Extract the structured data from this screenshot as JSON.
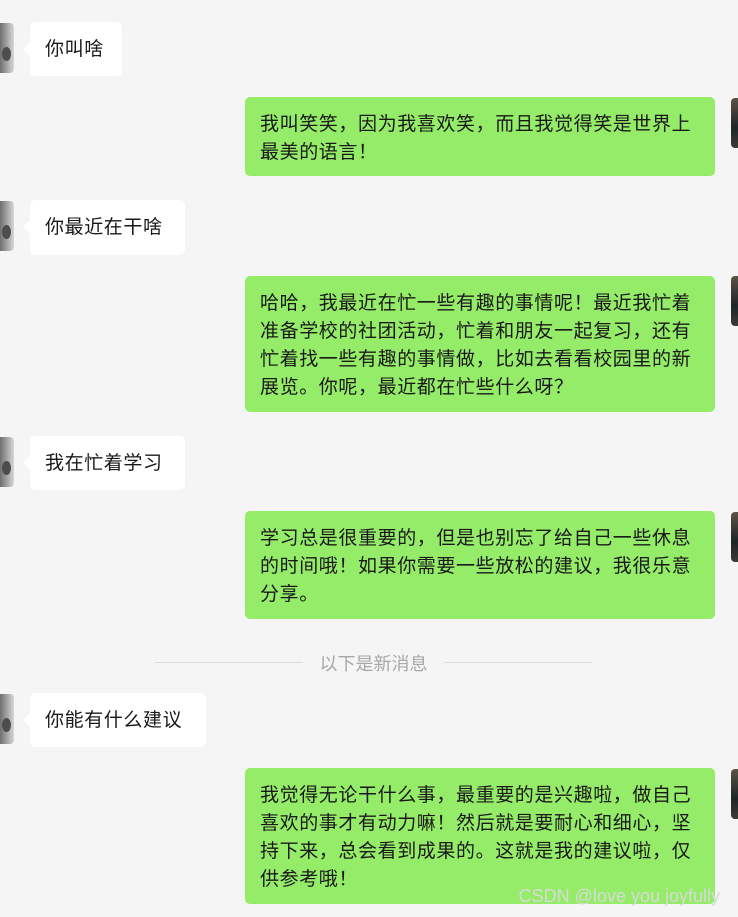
{
  "messages": [
    {
      "side": "left",
      "text": "你叫啥"
    },
    {
      "side": "right",
      "text": "我叫笑笑，因为我喜欢笑，而且我觉得笑是世界上最美的语言！"
    },
    {
      "side": "left",
      "text": "你最近在干啥"
    },
    {
      "side": "right",
      "text": "哈哈，我最近在忙一些有趣的事情呢！最近我忙着准备学校的社团活动，忙着和朋友一起复习，还有忙着找一些有趣的事情做，比如去看看校园里的新展览。你呢，最近都在忙些什么呀？"
    },
    {
      "side": "left",
      "text": "我在忙着学习"
    },
    {
      "side": "right",
      "text": "学习总是很重要的，但是也别忘了给自己一些休息的时间哦！如果你需要一些放松的建议，我很乐意分享。"
    },
    {
      "side": "left",
      "text": "你能有什么建议"
    },
    {
      "side": "right",
      "text": "我觉得无论干什么事，最重要的是兴趣啦，做自己喜欢的事才有动力嘛！然后就是要耐心和细心，坚持下来，总会看到成果的。这就是我的建议啦，仅供参考哦！"
    }
  ],
  "divider": {
    "text": "以下是新消息"
  },
  "watermark": {
    "text": "CSDN @love you joyfully"
  }
}
